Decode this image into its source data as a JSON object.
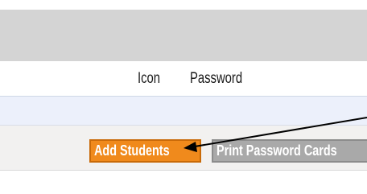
{
  "table": {
    "columns": [
      "Icon",
      "Password"
    ]
  },
  "toolbar": {
    "add_students_label": "Add Students",
    "print_password_cards_label": "Print Password Cards"
  },
  "colors": {
    "header_band": "#d4d4d4",
    "add_button": "#f08a1c",
    "print_button": "#a9a9a9",
    "row_highlight": "#ecf0fb"
  },
  "annotations": {
    "pointer_arrow": "arrow-icon"
  }
}
